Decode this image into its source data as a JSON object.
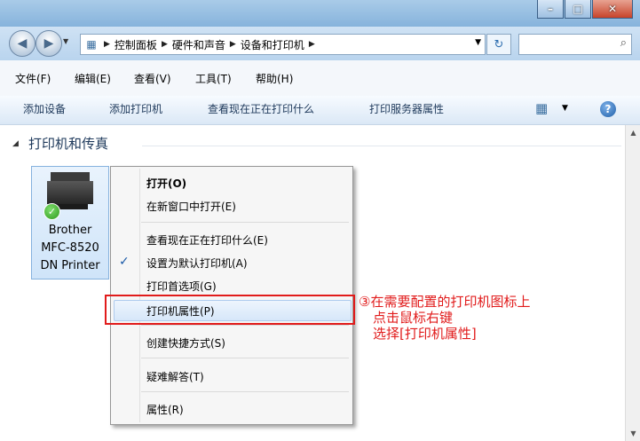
{
  "window": {
    "buttons": {
      "minimize": "–",
      "maximize": "□",
      "close": "✕"
    }
  },
  "address_bar": {
    "breadcrumbs": [
      "控制面板",
      "硬件和声音",
      "设备和打印机"
    ],
    "search_placeholder": ""
  },
  "menu": {
    "items": [
      "文件(F)",
      "编辑(E)",
      "查看(V)",
      "工具(T)",
      "帮助(H)"
    ]
  },
  "command_bar": {
    "items": [
      "添加设备",
      "添加打印机",
      "查看现在正在打印什么",
      "打印服务器属性"
    ],
    "help": "?"
  },
  "group": {
    "title": "打印机和传真"
  },
  "printer": {
    "label_lines": [
      "Brother",
      "MFC-8520",
      "DN Printer"
    ],
    "status": "✓"
  },
  "context_menu": {
    "items": [
      {
        "label": "打开(O)",
        "bold": true
      },
      {
        "label": "在新窗口中打开(E)"
      },
      {
        "label": "查看现在正在打印什么(E)"
      },
      {
        "label": "设置为默认打印机(A)",
        "checked": true
      },
      {
        "label": "打印首选项(G)"
      },
      {
        "label": "打印机属性(P)",
        "highlighted": true
      },
      {
        "label": "创建快捷方式(S)"
      },
      {
        "label": "疑难解答(T)"
      },
      {
        "label": "属性(R)"
      }
    ],
    "check_mark": "✓"
  },
  "annotation": {
    "lines": [
      "③在需要配置的打印机图标上",
      "点击鼠标右键",
      "选择[打印机属性]"
    ],
    "color": "#e11b1b"
  }
}
